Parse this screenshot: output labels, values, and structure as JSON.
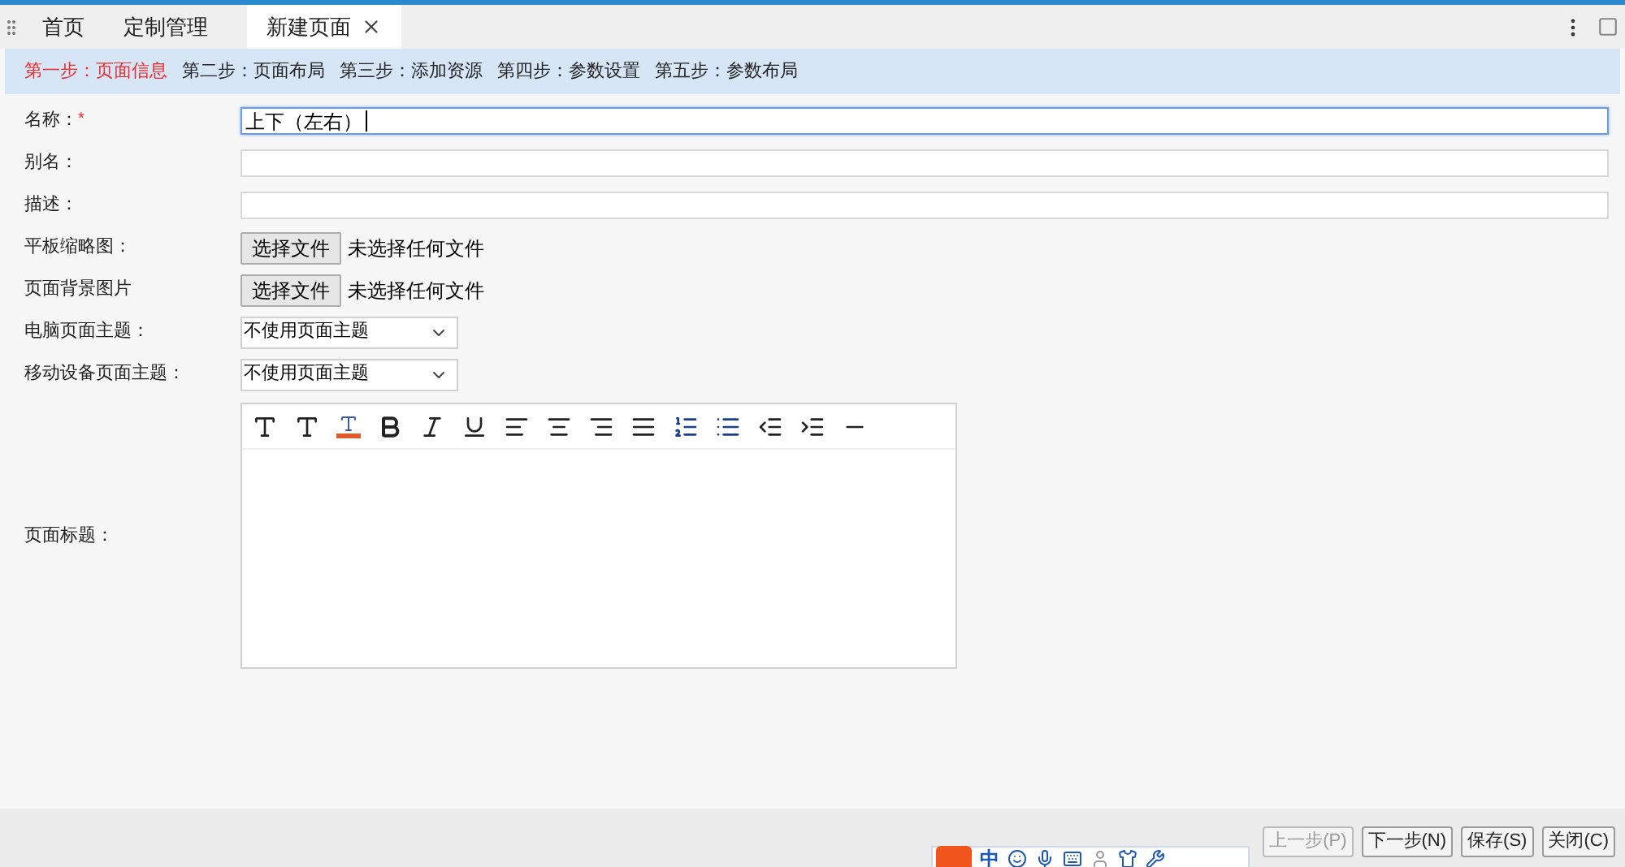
{
  "tabs": [
    {
      "label": "首页",
      "selected": false,
      "closable": false
    },
    {
      "label": "定制管理",
      "selected": false,
      "closable": false
    },
    {
      "label": "新建页面",
      "selected": true,
      "closable": true
    }
  ],
  "steps": [
    {
      "label": "第一步：页面信息",
      "selected": true
    },
    {
      "label": "第二步：页面布局",
      "selected": false
    },
    {
      "label": "第三步：添加资源",
      "selected": false
    },
    {
      "label": "第四步：参数设置",
      "selected": false
    },
    {
      "label": "第五步：参数布局",
      "selected": false
    }
  ],
  "form": [
    {
      "kind": "text",
      "label": "名称：",
      "mark": "*",
      "value": "上下（左右）",
      "focused": true
    },
    {
      "kind": "text",
      "label": "别名：",
      "focused": false
    },
    {
      "kind": "text",
      "label": "描述：",
      "focused": false
    },
    {
      "kind": "file",
      "label": "平板缩略图：",
      "button": "选择文件",
      "status": "未选择任何文件"
    },
    {
      "kind": "file",
      "label": "页面背景图片",
      "button": "选择文件",
      "status": "未选择任何文件"
    },
    {
      "kind": "select",
      "label": "电脑页面主题：",
      "value": "不使用页面主题"
    },
    {
      "kind": "select",
      "label": "移动设备页面主题：",
      "value": "不使用页面主题"
    },
    {
      "kind": "editor",
      "label": "页面标题："
    }
  ],
  "buttons": [
    {
      "label": "上一步(P)",
      "disabled": true
    },
    {
      "label": "下一步(N)",
      "disabled": false
    },
    {
      "label": "保存(S)",
      "disabled": false
    },
    {
      "label": "关闭(C)",
      "disabled": false
    }
  ],
  "ime": {
    "mode": "中"
  }
}
